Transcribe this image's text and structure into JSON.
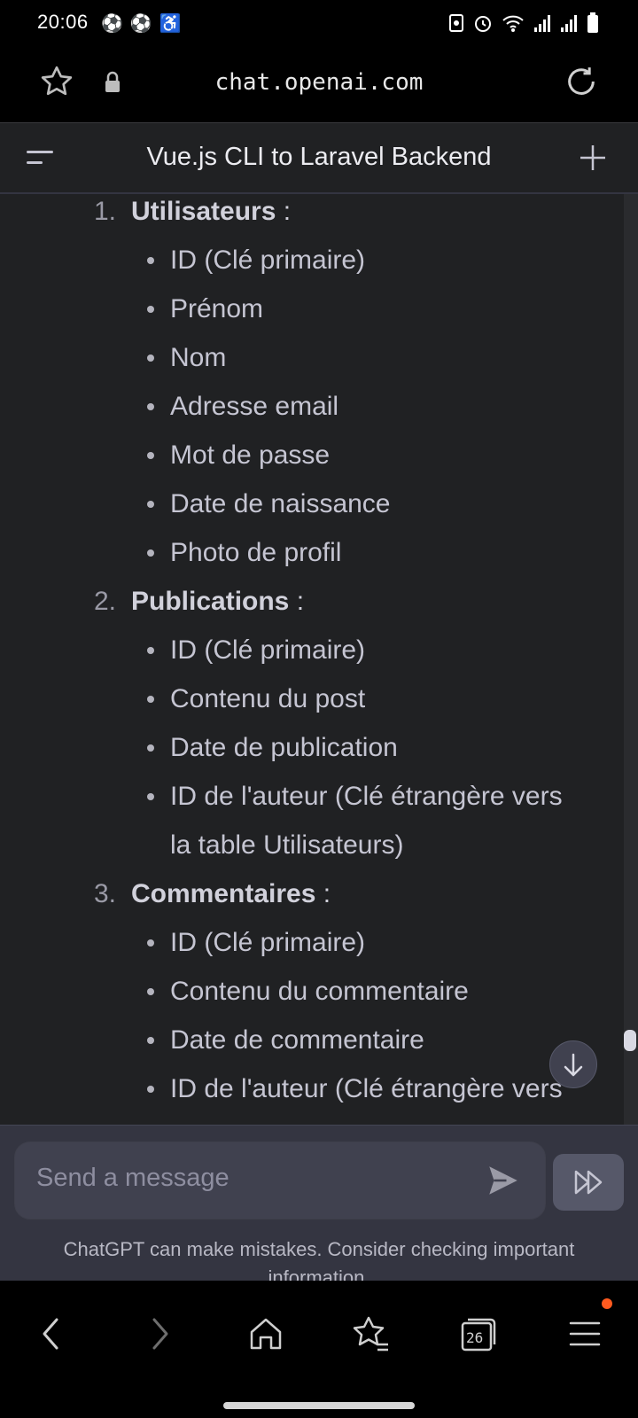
{
  "status_bar": {
    "time": "20:06",
    "left_icons": [
      "soccer-ball-icon",
      "soccer-ball-icon",
      "accessibility-icon"
    ],
    "right_icons": [
      "screenshot-icon",
      "alarm-icon",
      "wifi-icon",
      "signal-icon",
      "signal-icon",
      "battery-icon"
    ]
  },
  "browser": {
    "url": "chat.openai.com"
  },
  "chat_header": {
    "title": "Vue.js CLI to Laravel Backend"
  },
  "message": {
    "sections": [
      {
        "number": "1.",
        "heading": "Utilisateurs",
        "suffix": " :",
        "items": [
          "ID (Clé primaire)",
          "Prénom",
          "Nom",
          "Adresse email",
          "Mot de passe",
          "Date de naissance",
          "Photo de profil"
        ]
      },
      {
        "number": "2.",
        "heading": "Publications",
        "suffix": " :",
        "items": [
          "ID (Clé primaire)",
          "Contenu du post",
          "Date de publication",
          "ID de l'auteur (Clé étrangère vers la table Utilisateurs)"
        ],
        "wrapped_lines": [
          "ID de l'auteur (Clé étrangère vers",
          "la table Utilisateurs)"
        ]
      },
      {
        "number": "3.",
        "heading": "Commentaires",
        "suffix": " :",
        "items": [
          "ID (Clé primaire)",
          "Contenu du commentaire",
          "Date de commentaire",
          "ID de l'auteur (Clé étrangère vers"
        ]
      }
    ]
  },
  "composer": {
    "placeholder": "Send a message",
    "disclaimer": "ChatGPT can make mistakes. Consider checking important information."
  },
  "bottom_nav": {
    "tabs_count": "26"
  },
  "colors": {
    "chat_bg": "#202123",
    "composer_bg": "#343541",
    "accent_dot": "#ff5a1f"
  }
}
